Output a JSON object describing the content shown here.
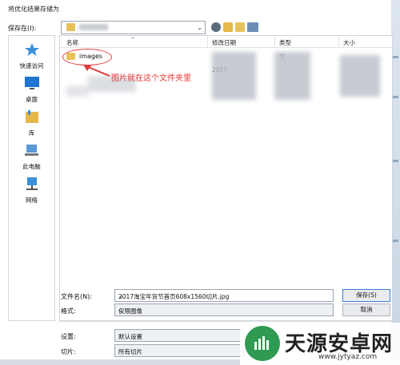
{
  "window": {
    "title": "将优化结果存储为"
  },
  "save_in": {
    "label": "保存在(I):"
  },
  "places": [
    {
      "label": "快速访问",
      "icon": "star-icon"
    },
    {
      "label": "桌面",
      "icon": "desktop-icon"
    },
    {
      "label": "库",
      "icon": "library-icon"
    },
    {
      "label": "此电脑",
      "icon": "computer-icon"
    },
    {
      "label": "网络",
      "icon": "network-icon"
    }
  ],
  "columns": [
    "名称",
    "修改日期",
    "类型",
    "大小"
  ],
  "files": [
    {
      "name": "images",
      "date": "2017",
      "type": "文"
    }
  ],
  "annotation": "图片就在这个文件夹里",
  "file_name": {
    "label": "文件名(N):",
    "value": "2017淘宝年货节首页608x1560切片.jpg"
  },
  "format": {
    "label": "格式:",
    "value": "仅限图像"
  },
  "buttons": {
    "save": "保存(S)",
    "cancel": "取消"
  },
  "settings": {
    "label": "设置:",
    "value": "默认设置"
  },
  "slices": {
    "label": "切片:",
    "value": "所有切片"
  },
  "watermark": {
    "title": "天源安卓网",
    "url": "www.jytyaz.com"
  },
  "colors": {
    "accent": "#3c7fd1",
    "annotation": "#e23b3b",
    "folder": "#e7c25b",
    "logo": "#2e9a52"
  }
}
